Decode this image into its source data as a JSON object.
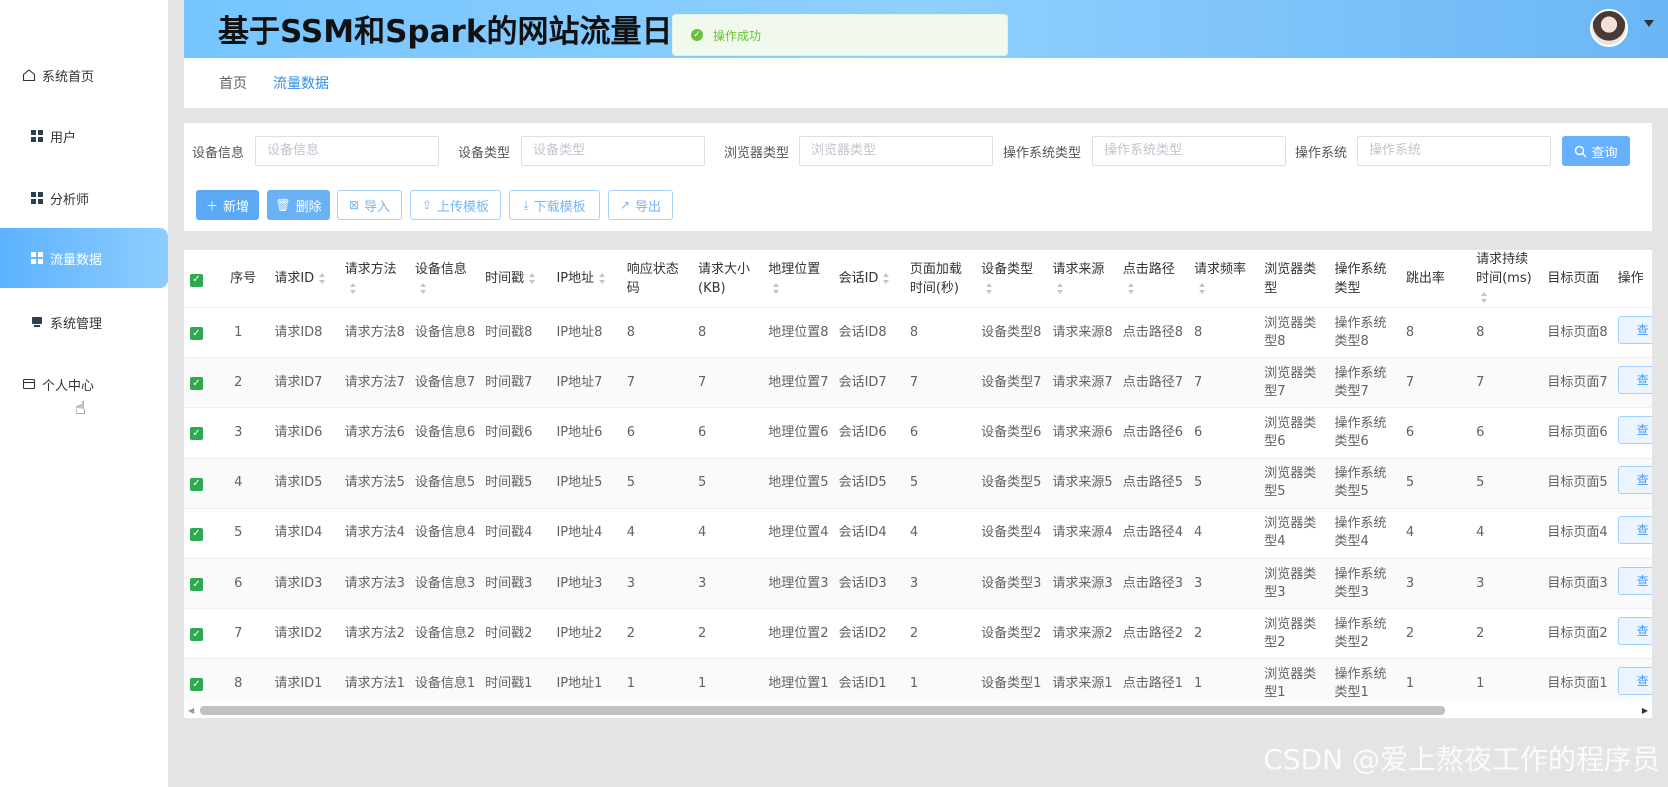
{
  "header": {
    "title": "基于SSM和Spark的网站流量日志数据可视化分析系统"
  },
  "toast": {
    "message": "操作成功"
  },
  "sidebar": {
    "items": [
      {
        "label": "系统首页",
        "icon": "home-icon"
      },
      {
        "label": "用户",
        "icon": "grid-icon"
      },
      {
        "label": "分析师",
        "icon": "grid-icon"
      },
      {
        "label": "流量数据",
        "icon": "grid-icon",
        "active": true
      },
      {
        "label": "系统管理",
        "icon": "monitor-icon"
      },
      {
        "label": "个人中心",
        "icon": "card-icon"
      }
    ]
  },
  "breadcrumb": [
    "首页",
    "流量数据"
  ],
  "search": {
    "fields": [
      {
        "label": "设备信息",
        "placeholder": "设备信息"
      },
      {
        "label": "设备类型",
        "placeholder": "设备类型"
      },
      {
        "label": "浏览器类型",
        "placeholder": "浏览器类型"
      },
      {
        "label": "操作系统类型",
        "placeholder": "操作系统类型"
      },
      {
        "label": "操作系统",
        "placeholder": "操作系统"
      }
    ],
    "query_label": "查询"
  },
  "toolbar": {
    "add": "新增",
    "delete": "删除",
    "import": "导入",
    "upload_template": "上传模板",
    "download_template": "下载模板",
    "export": "导出"
  },
  "table": {
    "columns": [
      "序号",
      "请求ID",
      "请求方法",
      "设备信息",
      "时间戳",
      "IP地址",
      "响应状态码",
      "请求大小(KB)",
      "地理位置",
      "会话ID",
      "页面加载时间(秒)",
      "设备类型",
      "请求来源",
      "点击路径",
      "请求频率",
      "浏览器类型",
      "操作系统类型",
      "跳出率",
      "请求持续时间(ms)",
      "目标页面",
      "操作"
    ],
    "rows": [
      [
        "1",
        "请求ID8",
        "请求方法8",
        "设备信息8",
        "时间戳8",
        "IP地址8",
        "8",
        "8",
        "地理位置8",
        "会话ID8",
        "8",
        "设备类型8",
        "请求来源8",
        "点击路径8",
        "8",
        "浏览器类型8",
        "操作系统类型8",
        "8",
        "8",
        "目标页面8"
      ],
      [
        "2",
        "请求ID7",
        "请求方法7",
        "设备信息7",
        "时间戳7",
        "IP地址7",
        "7",
        "7",
        "地理位置7",
        "会话ID7",
        "7",
        "设备类型7",
        "请求来源7",
        "点击路径7",
        "7",
        "浏览器类型7",
        "操作系统类型7",
        "7",
        "7",
        "目标页面7"
      ],
      [
        "3",
        "请求ID6",
        "请求方法6",
        "设备信息6",
        "时间戳6",
        "IP地址6",
        "6",
        "6",
        "地理位置6",
        "会话ID6",
        "6",
        "设备类型6",
        "请求来源6",
        "点击路径6",
        "6",
        "浏览器类型6",
        "操作系统类型6",
        "6",
        "6",
        "目标页面6"
      ],
      [
        "4",
        "请求ID5",
        "请求方法5",
        "设备信息5",
        "时间戳5",
        "IP地址5",
        "5",
        "5",
        "地理位置5",
        "会话ID5",
        "5",
        "设备类型5",
        "请求来源5",
        "点击路径5",
        "5",
        "浏览器类型5",
        "操作系统类型5",
        "5",
        "5",
        "目标页面5"
      ],
      [
        "5",
        "请求ID4",
        "请求方法4",
        "设备信息4",
        "时间戳4",
        "IP地址4",
        "4",
        "4",
        "地理位置4",
        "会话ID4",
        "4",
        "设备类型4",
        "请求来源4",
        "点击路径4",
        "4",
        "浏览器类型4",
        "操作系统类型4",
        "4",
        "4",
        "目标页面4"
      ],
      [
        "6",
        "请求ID3",
        "请求方法3",
        "设备信息3",
        "时间戳3",
        "IP地址3",
        "3",
        "3",
        "地理位置3",
        "会话ID3",
        "3",
        "设备类型3",
        "请求来源3",
        "点击路径3",
        "3",
        "浏览器类型3",
        "操作系统类型3",
        "3",
        "3",
        "目标页面3"
      ],
      [
        "7",
        "请求ID2",
        "请求方法2",
        "设备信息2",
        "时间戳2",
        "IP地址2",
        "2",
        "2",
        "地理位置2",
        "会话ID2",
        "2",
        "设备类型2",
        "请求来源2",
        "点击路径2",
        "2",
        "浏览器类型2",
        "操作系统类型2",
        "2",
        "2",
        "目标页面2"
      ],
      [
        "8",
        "请求ID1",
        "请求方法1",
        "设备信息1",
        "时间戳1",
        "IP地址1",
        "1",
        "1",
        "地理位置1",
        "会话ID1",
        "1",
        "设备类型1",
        "请求来源1",
        "点击路径1",
        "1",
        "浏览器类型1",
        "操作系统类型1",
        "1",
        "1",
        "目标页面1"
      ]
    ],
    "view_label": "查"
  },
  "watermark": "CSDN @爱上熬夜工作的程序员",
  "colors": {
    "accent": "#409eff",
    "sidebar_active": "#5cb2ff",
    "checkbox": "#2fa94f",
    "success": "#67c23a"
  }
}
